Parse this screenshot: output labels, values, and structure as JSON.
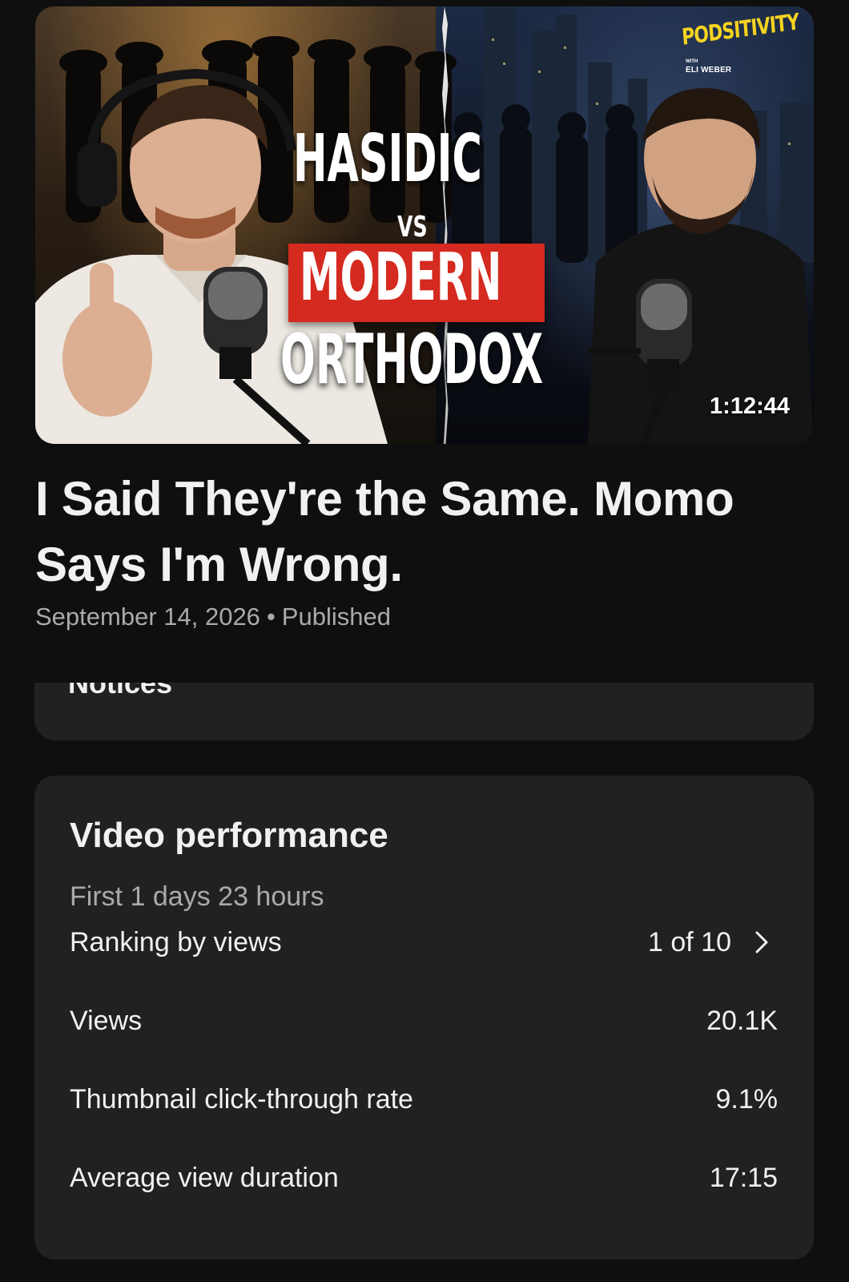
{
  "thumbnail": {
    "brand_name": "PODSITIVITY",
    "brand_with": "WITH",
    "brand_host": "ELI WEBER",
    "headline_1": "HASIDIC",
    "headline_vs": "VS",
    "headline_2": "MODERN",
    "headline_3": "ORTHODOX",
    "duration": "1:12:44",
    "colors": {
      "brand_yellow": "#f5d320",
      "banner_red": "#d42a1f"
    }
  },
  "video": {
    "title": "I Said They're the Same. Momo Says I'm Wrong.",
    "date": "September 14, 2026",
    "separator": "•",
    "status": "Published"
  },
  "notices": {
    "label": "Notices"
  },
  "performance": {
    "title": "Video performance",
    "period": "First 1 days 23 hours",
    "rows": [
      {
        "label": "Ranking by views",
        "value": "1 of 10",
        "icon": "chevron-right-icon"
      },
      {
        "label": "Views",
        "value": "20.1K"
      },
      {
        "label": "Thumbnail click-through rate",
        "value": "9.1%"
      },
      {
        "label": "Average view duration",
        "value": "17:15"
      }
    ]
  }
}
